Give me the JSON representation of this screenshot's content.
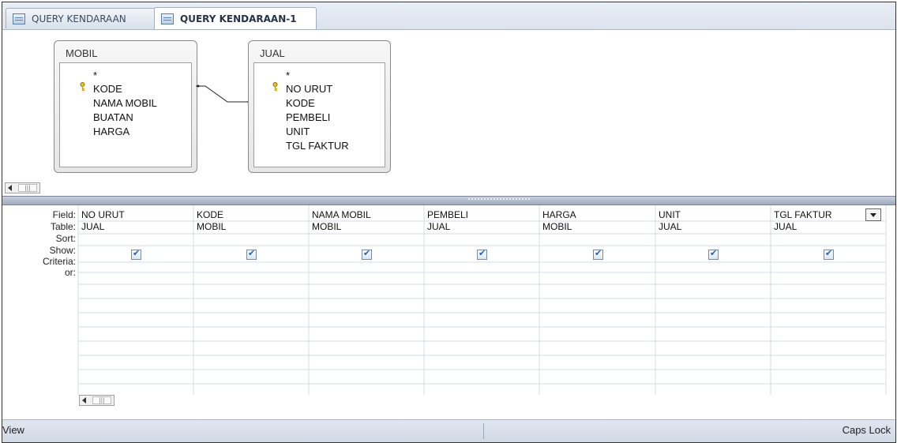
{
  "tabs": [
    {
      "label": "QUERY KENDARAAN",
      "active": false
    },
    {
      "label": "QUERY KENDARAAN-1",
      "active": true
    }
  ],
  "tables": [
    {
      "title": "MOBIL",
      "fields": [
        "*",
        "KODE",
        "NAMA MOBIL",
        "BUATAN",
        "HARGA"
      ],
      "key_field": "KODE"
    },
    {
      "title": "JUAL",
      "fields": [
        "*",
        "NO URUT",
        "KODE",
        "PEMBELI",
        "UNIT",
        "TGL FAKTUR"
      ],
      "key_field": "NO URUT"
    }
  ],
  "grid": {
    "row_labels": [
      "Field:",
      "Table:",
      "Sort:",
      "Show:",
      "Criteria:",
      "or:"
    ],
    "columns": [
      {
        "field": "NO URUT",
        "table": "JUAL",
        "show": true
      },
      {
        "field": "KODE",
        "table": "MOBIL",
        "show": true
      },
      {
        "field": "NAMA MOBIL",
        "table": "MOBIL",
        "show": true
      },
      {
        "field": "PEMBELI",
        "table": "JUAL",
        "show": true
      },
      {
        "field": "HARGA",
        "table": "MOBIL",
        "show": true
      },
      {
        "field": "UNIT",
        "table": "JUAL",
        "show": true
      },
      {
        "field": "TGL FAKTUR",
        "table": "JUAL",
        "show": true
      }
    ]
  },
  "status": {
    "left": "View",
    "right": "Caps Lock"
  },
  "colors": {
    "accent": "#2a5ea8",
    "tabbar": "#dbe3ee",
    "gridline": "#d4dbe6"
  },
  "icons": [
    "query-icon",
    "primary-key-icon",
    "checkbox-icon",
    "dropdown-arrow-icon",
    "scroll-left-icon"
  ]
}
